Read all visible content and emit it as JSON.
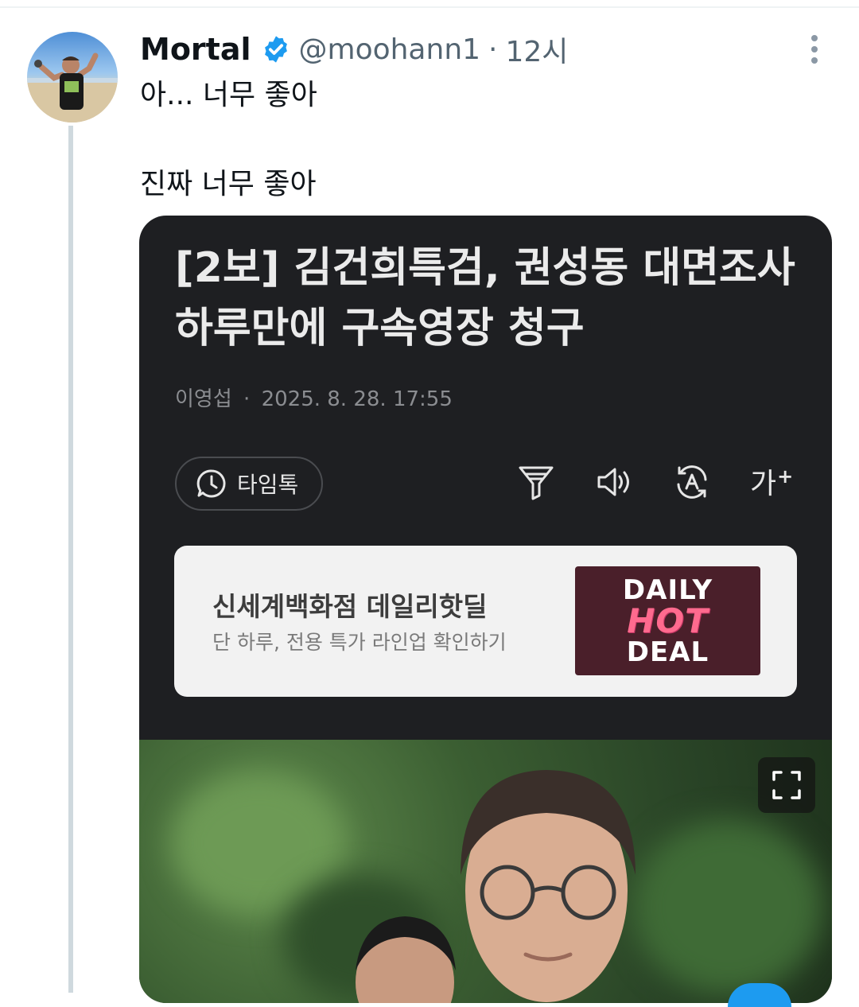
{
  "tweet": {
    "display_name": "Mortal",
    "handle": "@moohann1",
    "separator": "·",
    "time": "12시",
    "text_lines": [
      "아... 너무 좋아",
      "진짜 너무 좋아"
    ],
    "verified": true
  },
  "card": {
    "headline": "[2보] 김건희특검, 권성동 대면조사 하루만에 구속영장 청구",
    "author": "이영섭",
    "byline_separator": "·",
    "datetime": "2025. 8. 28. 17:55",
    "timetalk_label": "타임톡",
    "font_size_label": "가",
    "font_size_plus": "+",
    "ad": {
      "title": "신세계백화점 데일리핫딜",
      "subtitle": "단 하루, 전용 특가 라인업 확인하기",
      "thumb_words": [
        "DAILY",
        "HOT",
        "DEAL"
      ]
    }
  },
  "colors": {
    "verified": "#1d9bf0",
    "card_bg": "#1e1f22",
    "thread_line": "#cfd9de",
    "secondary_text": "#536471"
  },
  "icons": {
    "more": "more-vertical-icon",
    "verified": "verified-badge-icon",
    "timetalk": "clock-chat-icon",
    "filter": "filter-icon",
    "speaker": "speaker-icon",
    "translate": "translate-icon",
    "expand": "expand-icon"
  }
}
